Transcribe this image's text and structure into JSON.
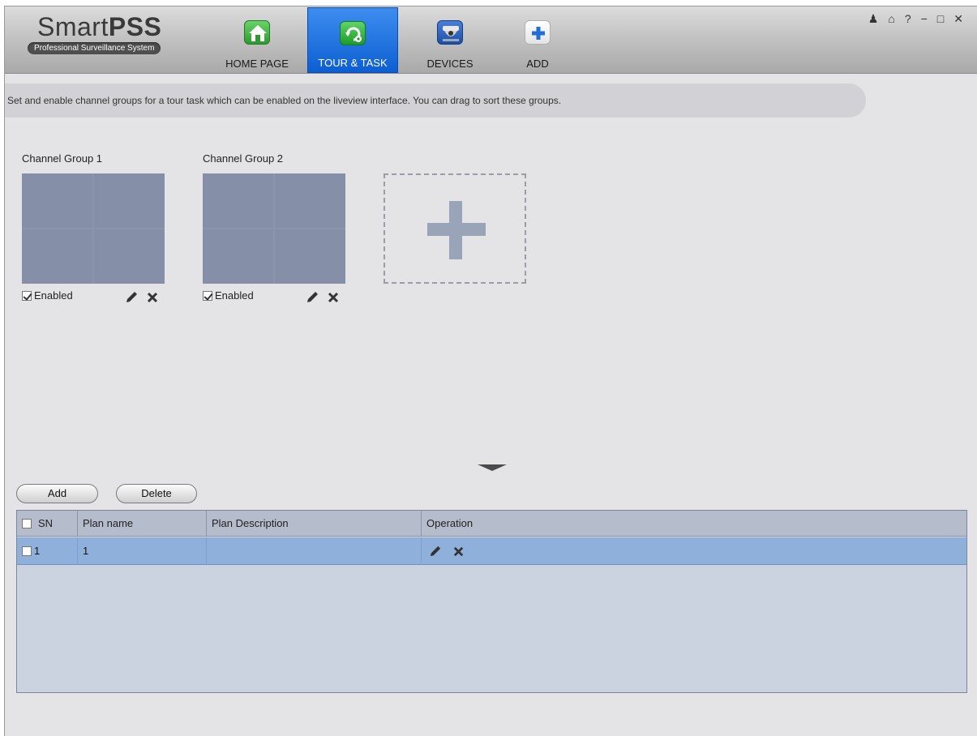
{
  "app": {
    "brand_light": "Smart",
    "brand_bold": "PSS",
    "subtitle": "Professional Surveillance System"
  },
  "nav": {
    "tabs": [
      {
        "label": "HOME PAGE",
        "icon": "home-icon",
        "color": "#3aa93a"
      },
      {
        "label": "TOUR & TASK",
        "icon": "tour-task-icon",
        "color": "#2fae3a",
        "active": true
      },
      {
        "label": "DEVICES",
        "icon": "camera-devices-icon",
        "color": "#2a5fb8"
      },
      {
        "label": "ADD",
        "icon": "plus-icon",
        "color": "#2a73d6"
      }
    ]
  },
  "window_controls": [
    "user-icon",
    "lock-icon",
    "help-icon",
    "minimize-icon",
    "maximize-icon",
    "close-icon"
  ],
  "window_control_glyphs": [
    "♟",
    "⌂",
    "?",
    "−",
    "□",
    "✕"
  ],
  "banner": {
    "text": "Set and enable channel groups for a tour task which can be enabled on the liveview interface. You can drag to sort these groups."
  },
  "channel_groups": [
    {
      "name": "Channel Group 1",
      "enabled": true,
      "enabled_label": "Enabled"
    },
    {
      "name": "Channel Group 2",
      "enabled": true,
      "enabled_label": "Enabled"
    }
  ],
  "buttons": {
    "add": "Add",
    "delete": "Delete"
  },
  "table": {
    "columns": [
      "SN",
      "Plan name",
      "Plan Description",
      "Operation"
    ],
    "rows": [
      {
        "sn": "1",
        "plan_name": "1",
        "plan_description": "",
        "checked": false
      }
    ]
  },
  "colors": {
    "accent_active_tab": "#1a6fe0",
    "selected_row": "#8eb0da",
    "grid_cell": "#8590a8"
  }
}
